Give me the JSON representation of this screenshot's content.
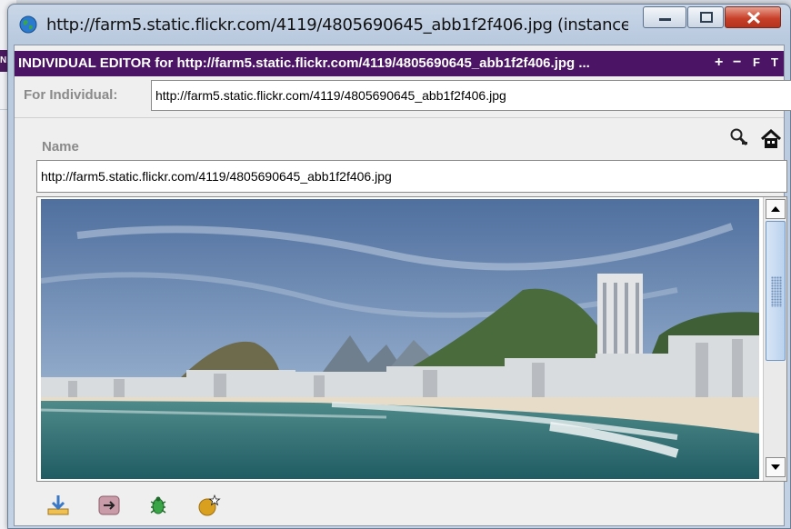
{
  "window": {
    "title": "http://farm5.static.flickr.com/4119/4805690645_abb1f2f406.jpg   (instance ..."
  },
  "background_app": {
    "strip_text": "N"
  },
  "editor": {
    "header_title": "INDIVIDUAL EDITOR for http://farm5.static.flickr.com/4119/4805690645_abb1f2f406.jpg ...",
    "header_buttons": {
      "add": "+",
      "remove": "−",
      "f": "F",
      "t": "T"
    },
    "for_individual_label": "For Individual:",
    "for_individual_value": "http://farm5.static.flickr.com/4119/4805690645_abb1f2f406.jpg",
    "name_label": "Name",
    "name_value": "http://farm5.static.flickr.com/4119/4805690645_abb1f2f406.jpg"
  },
  "icons": {
    "window": "globe-icon",
    "search": "search-icon",
    "home": "home-icon",
    "bottom": [
      "download-icon",
      "arrow-right-icon",
      "bug-icon",
      "new-object-icon"
    ]
  },
  "colors": {
    "header_bg": "#4b1464",
    "label_gray": "#8a8a8a",
    "close_red": "#c8412a"
  },
  "scrollbar": {
    "position_fraction": 0.0
  }
}
